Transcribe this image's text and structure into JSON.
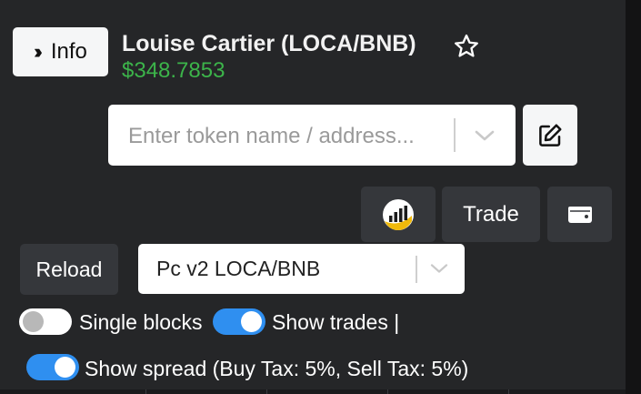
{
  "header": {
    "info_label": "Info",
    "token_title": "Louise Cartier (LOCA/BNB)",
    "token_price": "$348.7853"
  },
  "search": {
    "placeholder": "Enter token name / address..."
  },
  "toolbar": {
    "trade_label": "Trade",
    "reload_label": "Reload"
  },
  "pair_select": {
    "selected": "Pc v2 LOCA/BNB"
  },
  "toggles": {
    "single_blocks": {
      "label": "Single blocks",
      "on": false
    },
    "show_trades": {
      "label": "Show trades |",
      "on": true
    },
    "show_spread": {
      "label": "Show spread (Buy Tax: 5%, Sell Tax: 5%)",
      "on": true
    }
  },
  "colors": {
    "background": "#252628",
    "price_green": "#3cb44a",
    "toggle_blue": "#2f8ff0",
    "dark_button": "#35373b"
  },
  "icons": [
    "double-chevron-right-icon",
    "star-outline-icon",
    "chevron-down-icon",
    "edit-icon",
    "chart-logo-icon",
    "wallet-icon"
  ]
}
